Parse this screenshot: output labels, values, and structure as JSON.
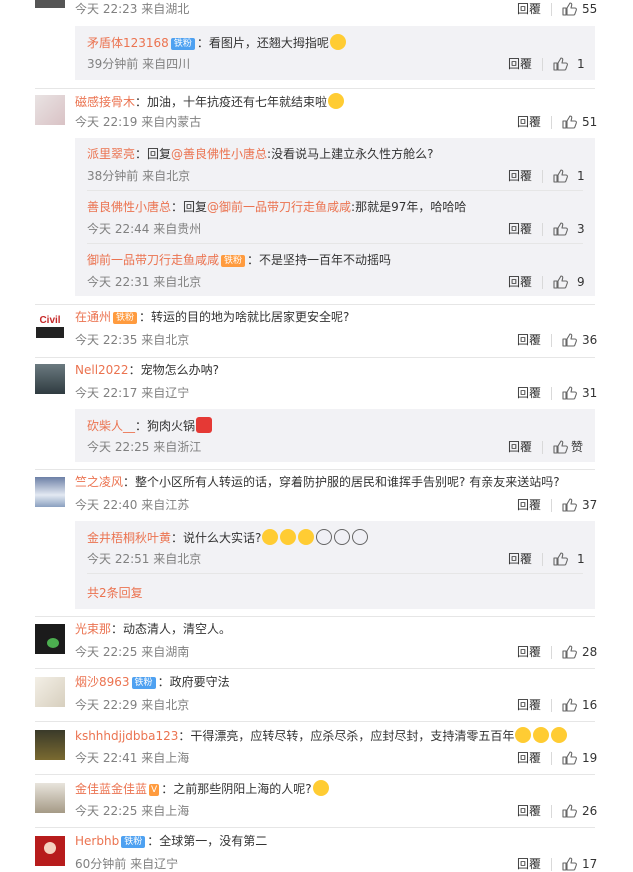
{
  "common": {
    "reply_label": "回覆"
  },
  "comments": [
    {
      "id": "c0",
      "time": "今天 22:23 来自湖北",
      "likes": "55"
    },
    {
      "id": "s0",
      "name": "矛盾体123168",
      "badge": "铁粉",
      "text": "：看图片，还翘大拇指呢",
      "time": "39分钟前 来自四川",
      "likes": "1"
    },
    {
      "id": "c1",
      "name": "磁感接骨木",
      "text": "：加油，十年抗疫还有七年就结束啦",
      "time": "今天 22:19 来自内蒙古",
      "likes": "51"
    },
    {
      "id": "s1",
      "name": "派里翠亮",
      "text_pre": "：回复",
      "mention": "@善良佛性小唐总",
      "text": ":没看说马上建立永久性方舱么?",
      "time": "38分钟前 来自北京",
      "likes": "1"
    },
    {
      "id": "s2",
      "name": "善良佛性小唐总",
      "text_pre": "：回复",
      "mention": "@御前一品带刀行走鱼咸咸",
      "text": ":那就是97年，哈哈哈",
      "time": "今天 22:44 来自贵州",
      "likes": "3"
    },
    {
      "id": "s3",
      "name": "御前一品带刀行走鱼咸咸",
      "badge": "铁粉",
      "text": "：不是坚持一百年不动摇吗",
      "time": "今天 22:31 来自北京",
      "likes": "9"
    },
    {
      "id": "c2",
      "name": "在通州",
      "badge": "铁粉",
      "text": "：转运的目的地为啥就比居家更安全呢?",
      "time": "今天 22:35 来自北京",
      "likes": "36",
      "avatar_text": "Civil"
    },
    {
      "id": "c3",
      "name": "Nell2022",
      "text": "：宠物怎么办呐?",
      "time": "今天 22:17 来自辽宁",
      "likes": "31"
    },
    {
      "id": "s4",
      "name": "砍柴人__",
      "text": "：狗肉火锅",
      "time": "今天 22:25 来自浙江",
      "likes": "赞"
    },
    {
      "id": "c4",
      "name": "竺之凌风",
      "text": "：整个小区所有人转运的话，穿着防护服的居民和谁挥手告别呢? 有亲友来送站吗?",
      "time": "今天 22:40 来自江苏",
      "likes": "37"
    },
    {
      "id": "s5",
      "name": "金井梧桐秋叶黄",
      "text": "：说什么大实话?",
      "time": "今天 22:51 来自北京",
      "likes": "1"
    },
    {
      "id": "more",
      "text": "共2条回复"
    },
    {
      "id": "c5",
      "name": "光束那",
      "text": "：动态清人，清空人。",
      "time": "今天 22:25 来自湖南",
      "likes": "28"
    },
    {
      "id": "c6",
      "name": "烟沙8963",
      "badge": "铁粉",
      "text": "：政府要守法",
      "time": "今天 22:29 来自北京",
      "likes": "16"
    },
    {
      "id": "c7",
      "name": "kshhhdjjdbba123",
      "text": "：干得漂亮，应转尽转，应杀尽杀，应封尽封，支持清零五百年",
      "time": "今天 22:41 来自上海",
      "likes": "19"
    },
    {
      "id": "c8",
      "name": "金佳蓝金佳蓝",
      "text": "：之前那些阴阳上海的人呢?",
      "time": "今天 22:25 来自上海",
      "likes": "26"
    },
    {
      "id": "c9",
      "name": "Herbhb",
      "badge": "铁粉",
      "text": "：全球第一，没有第二",
      "time": "60分钟前 来自辽宁",
      "likes": "17"
    }
  ],
  "colors": {
    "name": "#eb7350",
    "subbox": "#f2f2f5",
    "badge": "#4ea1f1"
  }
}
